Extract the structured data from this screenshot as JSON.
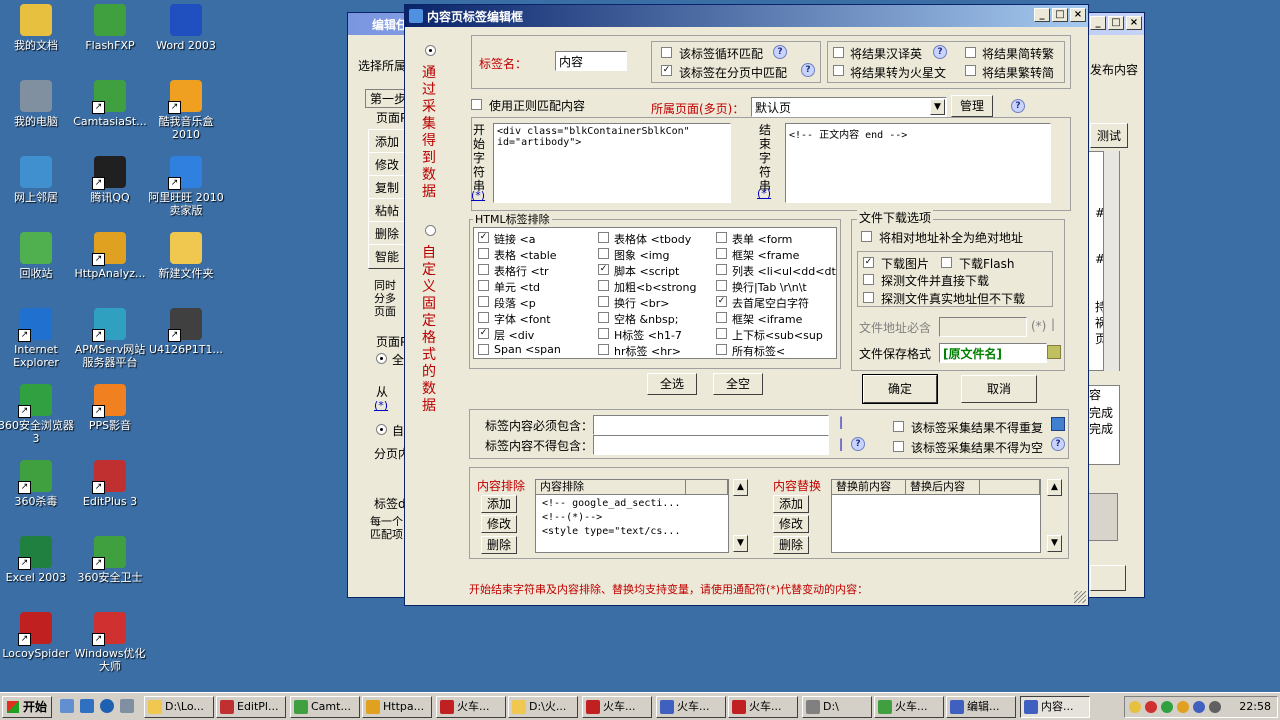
{
  "desktop": {
    "icons": [
      {
        "label": "我的文档",
        "color": "#e8c040"
      },
      {
        "label": "FlashFXP",
        "color": "#40a040"
      },
      {
        "label": "Word 2003",
        "color": "#2050c0"
      },
      {
        "label": "我的电脑",
        "color": "#8090a0"
      },
      {
        "label": "CamtasiaSt...",
        "color": "#40a040"
      },
      {
        "label": "酷我音乐盒 2010",
        "color": "#f0a020"
      },
      {
        "label": "网上邻居",
        "color": "#4090d0"
      },
      {
        "label": "腾讯QQ",
        "color": "#202020"
      },
      {
        "label": "阿里旺旺 2010 卖家版",
        "color": "#3080e0"
      },
      {
        "label": "回收站",
        "color": "#50b050"
      },
      {
        "label": "HttpAnalyz...",
        "color": "#e0a020"
      },
      {
        "label": "新建文件夹",
        "color": "#f0c850"
      },
      {
        "label": "Internet Explorer",
        "color": "#2070d0"
      },
      {
        "label": "APMServ网站服务器平台",
        "color": "#30a0c0"
      },
      {
        "label": "U4126P1T1...",
        "color": "#404040"
      },
      {
        "label": "360安全浏览器 3",
        "color": "#30a040"
      },
      {
        "label": "PPS影音",
        "color": "#f08020"
      },
      {
        "label": "360杀毒",
        "color": "#40a040"
      },
      {
        "label": "EditPlus 3",
        "color": "#c03030"
      },
      {
        "label": "Excel 2003",
        "color": "#208040"
      },
      {
        "label": "360安全卫士",
        "color": "#40a040"
      },
      {
        "label": "LocoySpider",
        "color": "#c02020"
      },
      {
        "label": "Windows优化大师",
        "color": "#d03030"
      }
    ]
  },
  "backwin": {
    "title": "编辑任",
    "select_label": "选择所属",
    "step_tab": "第一步",
    "page_group": "页面P",
    "buttons": [
      "添加",
      "修改",
      "复制",
      "粘帖",
      "删除",
      "智能"
    ],
    "sync_text": "同时分多页面",
    "page_group2": "页面P",
    "radio_all": "全",
    "from_label": "从",
    "radio_custom": "自启",
    "split_label": "分页内",
    "tag_group": "标签d",
    "each_text": "每一个匹配项",
    "publish": "发布内容",
    "test_btn": "测试",
    "right_texts": [
      "#",
      "#",
      "持",
      "祸",
      "页"
    ],
    "status1": "完成",
    "status2": "完成",
    "status0": "容"
  },
  "dialog": {
    "title": "内容页标签编辑框",
    "side_top": "通过采集得到数据",
    "side_bottom": "自定义固定格式的数据",
    "tag_name_label": "标签名：",
    "tag_name_value": "内容",
    "opt_loop": "该标签循环匹配",
    "opt_paging": "该标签在分页中匹配",
    "opt_translate": "将结果汉译英",
    "opt_mars": "将结果转为火星文",
    "opt_s2t": "将结果简转繁",
    "opt_t2s": "将结果繁转简",
    "use_regex": "使用正则匹配内容",
    "page_label": "所属页面(多页)：",
    "page_value": "默认页",
    "manage": "管理",
    "start_label": "开始字符串",
    "start_value": "<div class=\"blkContainerSblkCon\"\nid=\"artibody\">",
    "end_label": "结束字符串",
    "end_value": "<!-- 正文内容 end -->",
    "wildcard": "(*)",
    "html_group": "HTML标签排除",
    "html_tags": [
      {
        "label": "链接 <a",
        "on": true
      },
      {
        "label": "表格 <table",
        "on": false
      },
      {
        "label": "表格行 <tr",
        "on": false
      },
      {
        "label": "单元 <td",
        "on": false
      },
      {
        "label": "段落 <p",
        "on": false
      },
      {
        "label": "字体 <font",
        "on": false
      },
      {
        "label": "层 <div",
        "on": true
      },
      {
        "label": "Span <span",
        "on": false
      },
      {
        "label": "表格体 <tbody",
        "on": false
      },
      {
        "label": "图象 <img",
        "on": false
      },
      {
        "label": "脚本 <script",
        "on": true
      },
      {
        "label": "加粗<b<strong",
        "on": false
      },
      {
        "label": "换行 <br>",
        "on": false
      },
      {
        "label": "空格 &nbsp;",
        "on": false
      },
      {
        "label": "H标签 <h1-7",
        "on": false
      },
      {
        "label": "hr标签 <hr>",
        "on": false
      },
      {
        "label": "表单 <form",
        "on": false
      },
      {
        "label": "框架 <frame",
        "on": false
      },
      {
        "label": "列表 <li<ul<dd<dt",
        "on": false
      },
      {
        "label": "换行|Tab \\r\\n\\t",
        "on": false
      },
      {
        "label": "去首尾空白字符",
        "on": true
      },
      {
        "label": "框架 <iframe",
        "on": false
      },
      {
        "label": "上下标<sub<sup",
        "on": false
      },
      {
        "label": "所有标签<",
        "on": false
      }
    ],
    "select_all": "全选",
    "clear_all": "全空",
    "file_group": "文件下载选项",
    "file_abs": "将相对地址补全为绝对地址",
    "dl_image": "下载图片",
    "dl_flash": "下载Flash",
    "probe_direct": "探测文件并直接下载",
    "probe_real": "探测文件真实地址但不下载",
    "file_addr_label": "文件地址必含",
    "file_fmt_label": "文件保存格式",
    "file_fmt_value": "[原文件名]",
    "ok": "确定",
    "cancel": "取消",
    "must_include": "标签内容必须包含：",
    "must_exclude": "标签内容不得包含：",
    "pipe": "|",
    "no_repeat": "该标签采集结果不得重复",
    "no_empty": "该标签采集结果不得为空",
    "exclude_title": "内容排除",
    "exclude_header": "内容排除",
    "exclude_rows": [
      "<!-- google_ad_secti...",
      "<!--(*)-->",
      "<style type=\"text/cs..."
    ],
    "replace_title": "内容替换",
    "replace_before": "替换前内容",
    "replace_after": "替换后内容",
    "add": "添加",
    "modify": "修改",
    "delete": "删除",
    "footer": "开始结束字符串及内容排除、替换均支持变量，请使用通配符(*)代替变动的内容："
  },
  "taskbar": {
    "start": "开始",
    "tasks": [
      {
        "label": "D:\\Lo...",
        "color": "#f0c850"
      },
      {
        "label": "EditPl...",
        "color": "#c03030"
      },
      {
        "label": "Camt...",
        "color": "#40a040"
      },
      {
        "label": "Httpa...",
        "color": "#e0a020"
      },
      {
        "label": "火车...",
        "color": "#c02020"
      },
      {
        "label": "D:\\火...",
        "color": "#f0c850"
      },
      {
        "label": "火车...",
        "color": "#c02020"
      },
      {
        "label": "火车...",
        "color": "#4060c0"
      },
      {
        "label": "火车...",
        "color": "#c02020"
      },
      {
        "label": "D:\\",
        "color": "#808080"
      },
      {
        "label": "火车...",
        "color": "#40a040"
      },
      {
        "label": "编辑...",
        "color": "#4060c0"
      },
      {
        "label": "内容...",
        "color": "#4060c0"
      }
    ],
    "clock": "22:58"
  }
}
